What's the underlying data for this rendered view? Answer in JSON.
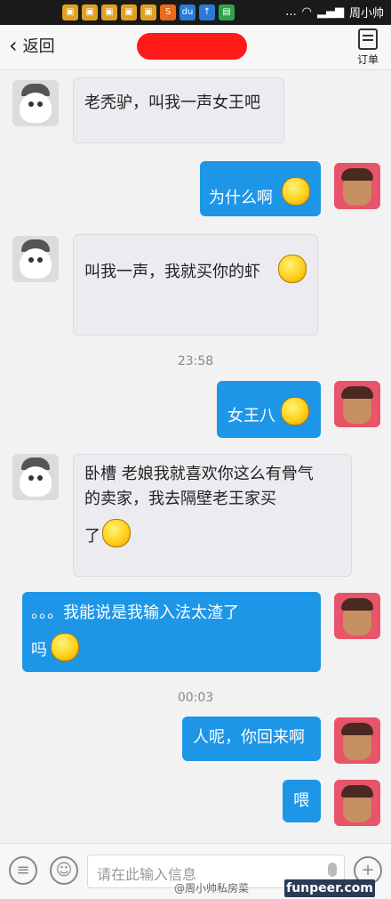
{
  "header": {
    "back_label": "返回",
    "order_label": "订单"
  },
  "statusbar": {
    "dots": "...",
    "carrier": "周小帅"
  },
  "messages": [
    {
      "side": "in",
      "text": "老秃驴，叫我一声女王吧"
    },
    {
      "side": "out",
      "text": "为什么啊"
    },
    {
      "side": "in",
      "text": "叫我一声，我就买你的虾"
    },
    {
      "side": "out",
      "text": "女王八"
    },
    {
      "side": "in",
      "line1": "卧槽 老娘我就喜欢你这么有骨气",
      "line2": "的卖家，我去隔壁老王家买",
      "line3": "了"
    },
    {
      "side": "out",
      "line1": "。。。我能说是我输入法太渣了",
      "line2": "吗"
    },
    {
      "side": "out",
      "text": "人呢，你回来啊"
    },
    {
      "side": "out",
      "text": "喂"
    }
  ],
  "times": [
    "23:58",
    "00:03"
  ],
  "input": {
    "placeholder": "请在此输入信息"
  },
  "watermark": "@周小帅私房菜",
  "site_badge": "funpeer.com",
  "colors": {
    "outgoing_bubble": "#1e96e8",
    "incoming_bubble": "#ececf0",
    "redaction": "#ff1a1a"
  },
  "icons": [
    "back-chevron-icon",
    "order-icon",
    "comment-icon",
    "emoji-icon",
    "mic-icon",
    "plus-icon"
  ]
}
